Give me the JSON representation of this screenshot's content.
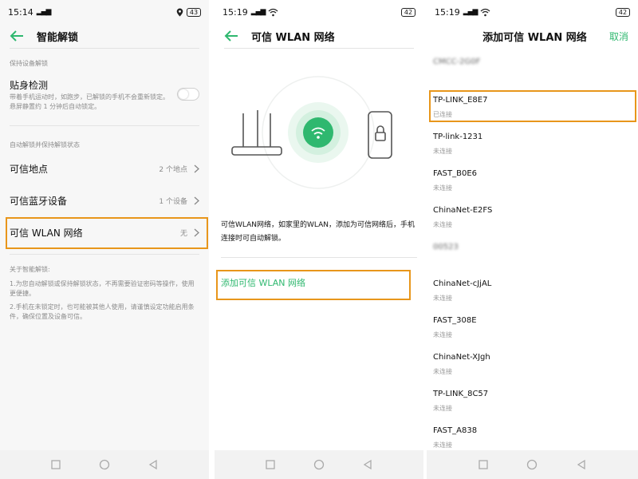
{
  "accent": "#2fb86f",
  "highlight": "#e8961b",
  "screen1": {
    "status": {
      "time": "15:14",
      "battery": "43"
    },
    "title": "智能解锁",
    "section1": "保持设备解锁",
    "on_body": {
      "label": "贴身检测",
      "desc": "带着手机运动时，如跑步，已解锁的手机不会重新锁定。悬屏静置约 1 分钟后自动锁定。"
    },
    "section2": "自动解锁并保持解锁状态",
    "rows": [
      {
        "label": "可信地点",
        "value": "2 个地点"
      },
      {
        "label": "可信蓝牙设备",
        "value": "1 个设备"
      },
      {
        "label": "可信 WLAN 网络",
        "value": "无"
      }
    ],
    "about_title": "关于智能解锁:",
    "about_1": "1.为您自动解锁或保持解锁状态，不再需要验证密码等操作，使用更便捷。",
    "about_2": "2.手机在未锁定时，也可能被其他人使用，请谨慎设定功能启用条件，确保位置及设备可信。"
  },
  "screen2": {
    "status": {
      "time": "15:19",
      "battery": "42"
    },
    "title": "可信 WLAN 网络",
    "desc": "可信WLAN网络，如家里的WLAN，添加为可信网络后，手机连接时可自动解锁。",
    "add_label": "添加可信 WLAN 网络"
  },
  "screen3": {
    "status": {
      "time": "15:19",
      "battery": "42"
    },
    "title": "添加可信 WLAN 网络",
    "cancel": "取消",
    "networks": [
      {
        "name": "CMCC-2G0F",
        "state": ""
      },
      {
        "name": "TP-LINK_E8E7",
        "state": "已连接"
      },
      {
        "name": "TP-link-1231",
        "state": "未连接"
      },
      {
        "name": "FAST_B0E6",
        "state": "未连接"
      },
      {
        "name": "ChinaNet-E2FS",
        "state": "未连接"
      },
      {
        "name": "00523",
        "state": ""
      },
      {
        "name": "ChinaNet-cJjAL",
        "state": "未连接"
      },
      {
        "name": "FAST_308E",
        "state": "未连接"
      },
      {
        "name": "ChinaNet-XJgh",
        "state": "未连接"
      },
      {
        "name": "TP-LINK_8C57",
        "state": "未连接"
      },
      {
        "name": "FAST_A838",
        "state": "未连接"
      }
    ]
  }
}
